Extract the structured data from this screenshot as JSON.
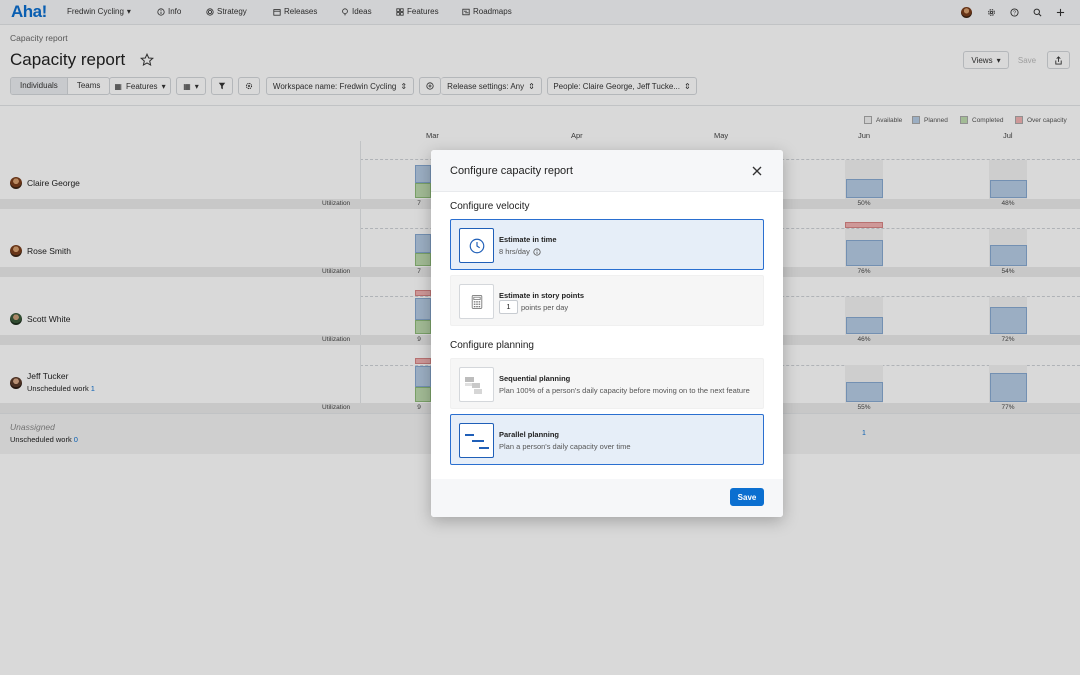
{
  "nav": {
    "logo": "Aha!",
    "workspace": "Fredwin Cycling",
    "items": [
      "Info",
      "Strategy",
      "Releases",
      "Ideas",
      "Features",
      "Roadmaps"
    ]
  },
  "header": {
    "breadcrumb": "Capacity report",
    "title": "Capacity report",
    "views_label": "Views",
    "save_label": "Save"
  },
  "filters": {
    "individuals": "Individuals",
    "teams": "Teams",
    "features": "Features",
    "workspace": "Workspace name: Fredwin Cycling",
    "release_settings": "Release settings: Any",
    "people": "People: Claire George, Jeff Tucke..."
  },
  "legend": [
    "Available",
    "Planned",
    "Completed",
    "Over capacity"
  ],
  "months": [
    "Mar",
    "Apr",
    "May",
    "Jun",
    "Jul"
  ],
  "people": [
    {
      "name": "Claire George",
      "jun_pct": "50%",
      "jul_pct": "48%",
      "mar_pct": "7"
    },
    {
      "name": "Rose Smith",
      "jun_pct": "76%",
      "jul_pct": "54%",
      "mar_pct": "7"
    },
    {
      "name": "Scott White",
      "jun_pct": "46%",
      "jul_pct": "72%",
      "mar_pct": "9"
    },
    {
      "name": "Jeff Tucker",
      "jun_pct": "55%",
      "jul_pct": "77%",
      "mar_pct": "9",
      "unscheduled_label": "Unscheduled work",
      "unscheduled_count": "1"
    }
  ],
  "utilization_label": "Utilization",
  "unassigned": {
    "label": "Unassigned",
    "unscheduled_label": "Unscheduled work",
    "unscheduled_count": "0",
    "jun_count": "1"
  },
  "modal": {
    "title": "Configure capacity report",
    "velocity_title": "Configure velocity",
    "time_label": "Estimate in time",
    "time_desc": "8 hrs/day",
    "points_label": "Estimate in story points",
    "points_value": "1",
    "points_desc": "points per day",
    "planning_title": "Configure planning",
    "sequential_label": "Sequential planning",
    "sequential_desc": "Plan 100% of a person's daily capacity before moving on to the next feature",
    "parallel_label": "Parallel planning",
    "parallel_desc": "Plan a person's daily capacity over time",
    "save_label": "Save"
  },
  "colors": {
    "brand": "#0b6fd0",
    "planned": "#b7cde6",
    "completed": "#bfdcb0",
    "over": "#f3b3b3"
  }
}
